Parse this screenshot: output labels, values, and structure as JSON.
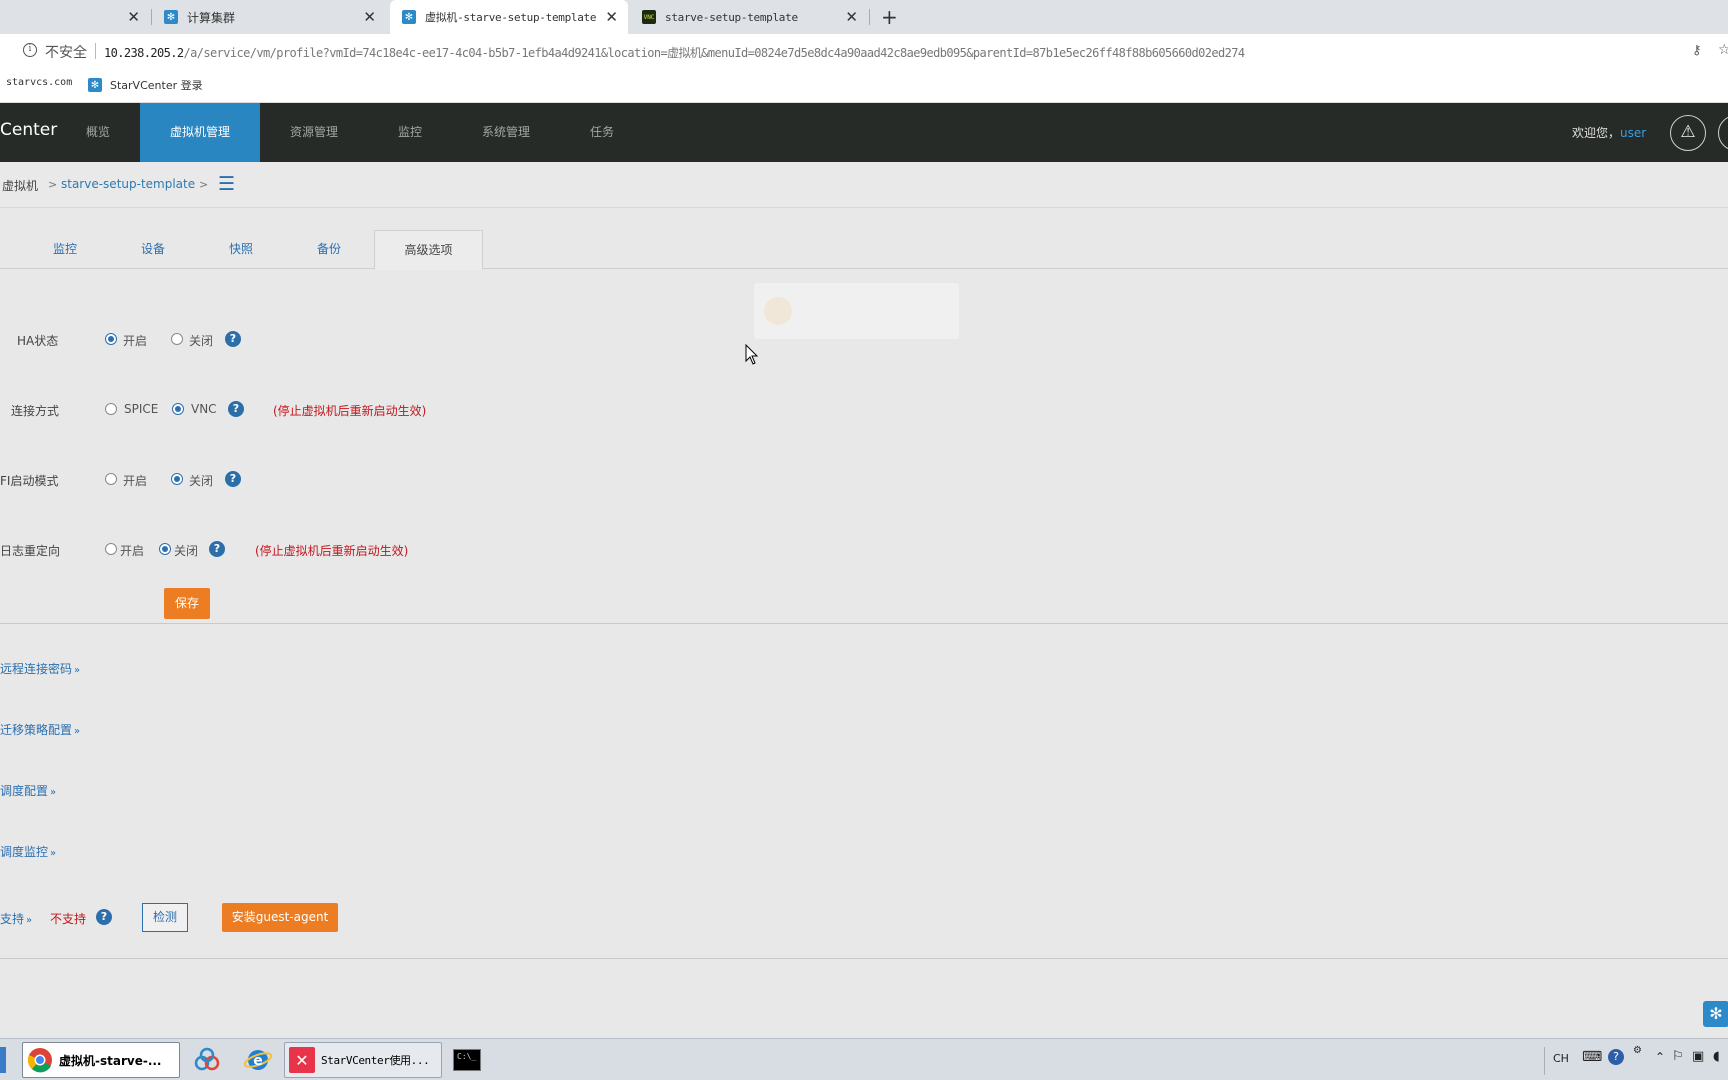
{
  "browser": {
    "tabs": [
      {
        "title": "",
        "favicon": "none"
      },
      {
        "title": "计算集群",
        "favicon": "starvcenter"
      },
      {
        "title": "虚拟机-starve-setup-template",
        "favicon": "starvcenter",
        "active": true
      },
      {
        "title": "starve-setup-template",
        "favicon": "vnc"
      }
    ],
    "address": {
      "insecure_label": "不安全",
      "host": "10.238.205.2",
      "path": "/a/service/vm/profile?vmId=74c18e4c-ee17-4c04-b5b7-1efb4a4d9241&location=虚拟机&menuId=0824e7d5e8dc4a90aad42c8ae9edb095&parentId=87b1e5ec26ff48f88b605660d02ed274"
    },
    "bookmarks": [
      {
        "label": "starvcs.com"
      },
      {
        "label": "StarVCenter 登录"
      }
    ]
  },
  "app": {
    "brand": "Center",
    "nav": [
      "概览",
      "虚拟机管理",
      "资源管理",
      "监控",
      "系统管理",
      "任务"
    ],
    "welcome": "欢迎您，",
    "user": "user"
  },
  "breadcrumb": {
    "root": "虚拟机",
    "sep": ">",
    "vm": "starve-setup-template"
  },
  "tabs": [
    "监控",
    "设备",
    "快照",
    "备份",
    "高级选项"
  ],
  "settings": {
    "ha": {
      "label": "HA状态",
      "opt_on": "开启",
      "opt_off": "关闭"
    },
    "conn": {
      "label": "连接方式",
      "opt_spice": "SPICE",
      "opt_vnc": "VNC",
      "note": "(停止虚拟机后重新启动生效)"
    },
    "uefi": {
      "label": "FI启动模式",
      "opt_on": "开启",
      "opt_off": "关闭"
    },
    "log": {
      "label": "日志重定向",
      "opt_on": "开启",
      "opt_off": "关闭",
      "note": "(停止虚拟机后重新启动生效)"
    },
    "save": "保存"
  },
  "sections": {
    "remote_password": "远程连接密码",
    "migration": "迁移策略配置",
    "schedule_config": "调度配置",
    "schedule_monitor": "调度监控",
    "support_label": "支持",
    "support_status": "不支持",
    "check_btn": "检测",
    "install_btn": "安装guest-agent",
    "arrow": "»"
  },
  "taskbar": {
    "chrome_title": "虚拟机-starve-...",
    "starv_title": "StarVCenter使用...",
    "lang": "CH"
  },
  "colors": {
    "nav_active": "#2a86c1",
    "accent_orange": "#ed7d22",
    "warning_red": "#c4161c",
    "link_blue": "#2a6fb0"
  }
}
